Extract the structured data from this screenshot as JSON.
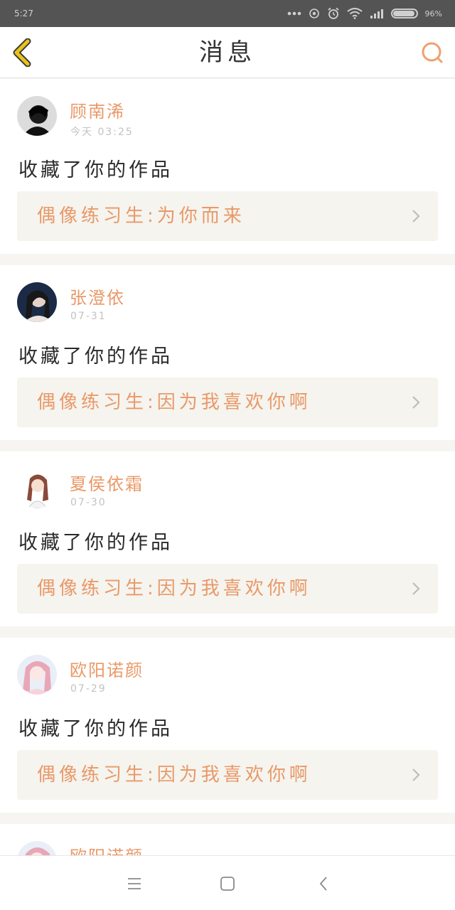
{
  "status_bar": {
    "time": "5:27",
    "battery_pct": "96%",
    "battery_level": 0.96
  },
  "header": {
    "title": "消息",
    "back_icon": "chevron-left-icon",
    "search_icon": "search-icon"
  },
  "colors": {
    "accent": "#e99968",
    "back_icon": "#e8c318",
    "card_link_bg": "#f5f4ef"
  },
  "notifications": [
    {
      "name": "顾南浠",
      "time": "今天 03:25",
      "action": "收藏了你的作品",
      "work": "偶像练习生:为你而来"
    },
    {
      "name": "张澄依",
      "time": "07-31",
      "action": "收藏了你的作品",
      "work": "偶像练习生:因为我喜欢你啊"
    },
    {
      "name": "夏侯依霜",
      "time": "07-30",
      "action": "收藏了你的作品",
      "work": "偶像练习生:因为我喜欢你啊"
    },
    {
      "name": "欧阳诺颜",
      "time": "07-29",
      "action": "收藏了你的作品",
      "work": "偶像练习生:因为我喜欢你啊"
    },
    {
      "name": "欧阳诺颜"
    }
  ]
}
